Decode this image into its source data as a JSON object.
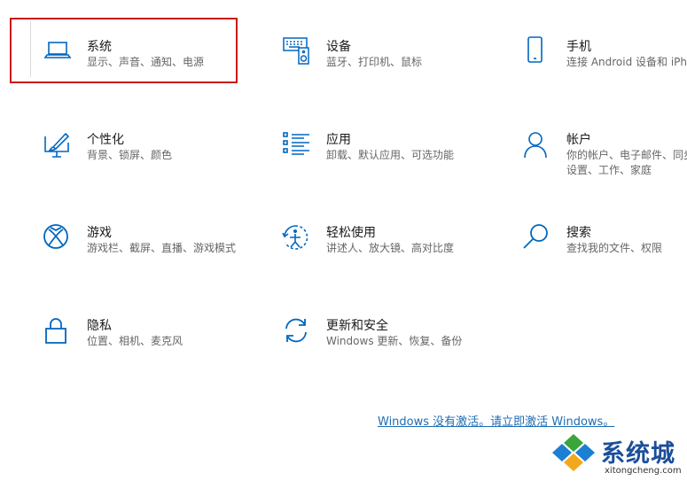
{
  "settings": {
    "tiles": [
      {
        "title": "系统",
        "desc": "显示、声音、通知、电源",
        "icon": "laptop-icon"
      },
      {
        "title": "设备",
        "desc": "蓝牙、打印机、鼠标",
        "icon": "keyboard-speaker-icon"
      },
      {
        "title": "手机",
        "desc": "连接 Android 设备和 iPhone",
        "icon": "phone-icon"
      },
      {
        "title": "个性化",
        "desc": "背景、锁屏、颜色",
        "icon": "paint-monitor-icon"
      },
      {
        "title": "应用",
        "desc": "卸载、默认应用、可选功能",
        "icon": "apps-list-icon"
      },
      {
        "title": "帐户",
        "desc": "你的帐户、电子邮件、同步设置、工作、家庭",
        "icon": "person-icon"
      },
      {
        "title": "游戏",
        "desc": "游戏栏、截屏、直播、游戏模式",
        "icon": "xbox-icon"
      },
      {
        "title": "轻松使用",
        "desc": "讲述人、放大镜、高对比度",
        "icon": "ease-of-access-icon"
      },
      {
        "title": "搜索",
        "desc": "查找我的文件、权限",
        "icon": "search-icon"
      },
      {
        "title": "隐私",
        "desc": "位置、相机、麦克风",
        "icon": "lock-icon"
      },
      {
        "title": "更新和安全",
        "desc": "Windows 更新、恢复、备份",
        "icon": "sync-icon"
      }
    ]
  },
  "activation": {
    "text": "Windows 没有激活。请立即激活 Windows。"
  },
  "watermark": {
    "brand": "系统城",
    "url": "xitongcheng.com"
  },
  "colors": {
    "accent": "#0067c0",
    "highlight": "#c81a1a",
    "link": "#1d6db5"
  }
}
